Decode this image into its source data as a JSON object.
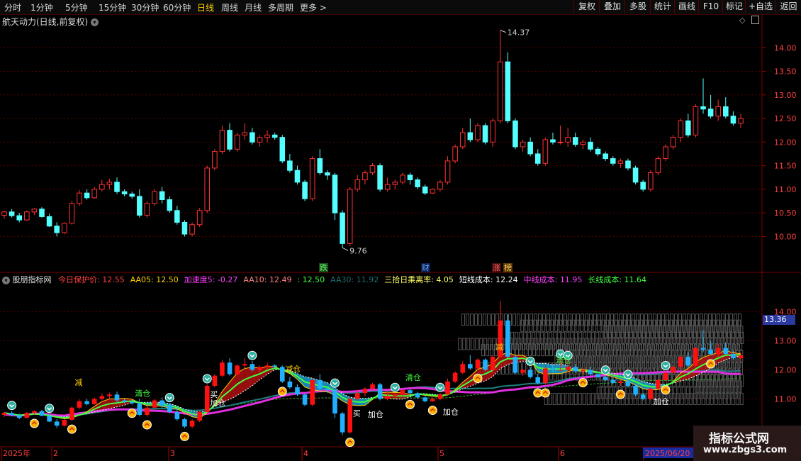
{
  "toolbar": {
    "periods": [
      {
        "label": "分时",
        "active": false
      },
      {
        "label": "1分钟",
        "active": false
      },
      {
        "label": "5分钟",
        "active": false
      },
      {
        "label": "15分钟",
        "active": false
      },
      {
        "label": "30分钟",
        "active": false
      },
      {
        "label": "60分钟",
        "active": false
      },
      {
        "label": "日线",
        "active": true
      },
      {
        "label": "周线",
        "active": false
      },
      {
        "label": "月线",
        "active": false
      },
      {
        "label": "多周期",
        "active": false
      },
      {
        "label": "更多",
        "active": false
      }
    ],
    "more_arrow": ">",
    "buttons": [
      "复权",
      "叠加",
      "多股",
      "统计",
      "画线",
      "F10",
      "标记",
      "+自选",
      "返回"
    ]
  },
  "stock": {
    "title": "航天动力(日线,前复权)",
    "high_label": "14.37",
    "low_label": "9.76",
    "event_markers": [
      "跌",
      "财",
      "涨",
      "榜"
    ]
  },
  "indicator": {
    "name": "股朋指标网",
    "params": [
      {
        "text": "今日保护价: 12.55",
        "color": "#ff4040"
      },
      {
        "text": "AA05: 12.50",
        "color": "#ffd200"
      },
      {
        "text": "加速度5: -0.27",
        "color": "#ff40ff"
      },
      {
        "text": "AA10: 12.49",
        "color": "#ff8080"
      },
      {
        "text": ": 12.50",
        "color": "#40ff40"
      },
      {
        "text": "AA30: 11.92",
        "color": "#1e6e6e"
      },
      {
        "text": "三拾日乘离率: 4.05",
        "color": "#ffff60"
      },
      {
        "text": "短线成本: 12.24",
        "color": "#ffffff"
      },
      {
        "text": "中线成本: 11.95",
        "color": "#ff40ff"
      },
      {
        "text": "长线成本: 11.64",
        "color": "#40ff40"
      }
    ],
    "current_value": "13.36",
    "signals": {
      "jian": "减",
      "qing": "清仓",
      "jiacang": "加仓",
      "mai": "买",
      "jianc": "减仓"
    }
  },
  "price_axis": {
    "main": [
      "14.00",
      "13.50",
      "13.00",
      "12.50",
      "12.00",
      "11.50",
      "11.00",
      "10.50",
      "10.00"
    ],
    "sub": [
      "14.00",
      "13.00",
      "12.00",
      "11.00"
    ]
  },
  "date_axis": {
    "labels": [
      {
        "text": "2025年"
      },
      {
        "text": "2"
      },
      {
        "text": "3"
      },
      {
        "text": "4"
      },
      {
        "text": "5"
      },
      {
        "text": "6"
      },
      {
        "text": "2025/06/20"
      }
    ]
  },
  "watermark": {
    "title": "指标公式网",
    "url": "www.zbgs3.com"
  },
  "chart_data": {
    "type": "candlestick",
    "title": "航天动力(日线,前复权)",
    "ylim": [
      9.6,
      14.5
    ],
    "bull_color": "#ff3232",
    "bear_color": "#54ffff",
    "candles": [
      [
        10.45,
        10.55,
        10.38,
        10.52
      ],
      [
        10.52,
        10.58,
        10.4,
        10.44
      ],
      [
        10.44,
        10.5,
        10.3,
        10.35
      ],
      [
        10.35,
        10.55,
        10.33,
        10.52
      ],
      [
        10.52,
        10.6,
        10.45,
        10.58
      ],
      [
        10.58,
        10.62,
        10.4,
        10.42
      ],
      [
        10.42,
        10.48,
        10.2,
        10.22
      ],
      [
        10.22,
        10.3,
        10.0,
        10.08
      ],
      [
        10.08,
        10.3,
        10.05,
        10.28
      ],
      [
        10.28,
        10.75,
        10.25,
        10.7
      ],
      [
        10.7,
        10.98,
        10.65,
        10.92
      ],
      [
        10.92,
        11.0,
        10.78,
        10.82
      ],
      [
        10.82,
        11.05,
        10.8,
        11.0
      ],
      [
        11.0,
        11.2,
        10.95,
        11.1
      ],
      [
        11.1,
        11.22,
        11.0,
        11.15
      ],
      [
        11.15,
        11.25,
        10.9,
        10.95
      ],
      [
        10.95,
        11.0,
        10.85,
        10.9
      ],
      [
        10.9,
        10.95,
        10.8,
        10.85
      ],
      [
        10.85,
        11.0,
        10.4,
        10.45
      ],
      [
        10.45,
        10.75,
        10.4,
        10.7
      ],
      [
        10.7,
        11.0,
        10.65,
        10.95
      ],
      [
        10.95,
        11.05,
        10.7,
        10.78
      ],
      [
        10.78,
        10.85,
        10.5,
        10.55
      ],
      [
        10.55,
        10.65,
        10.25,
        10.3
      ],
      [
        10.3,
        10.35,
        10.0,
        10.05
      ],
      [
        10.05,
        10.3,
        10.0,
        10.25
      ],
      [
        10.25,
        10.6,
        10.2,
        10.55
      ],
      [
        10.55,
        11.5,
        10.5,
        11.45
      ],
      [
        11.45,
        11.85,
        11.4,
        11.8
      ],
      [
        11.8,
        12.35,
        11.75,
        12.25
      ],
      [
        12.25,
        12.4,
        11.8,
        11.85
      ],
      [
        11.85,
        12.2,
        11.8,
        12.15
      ],
      [
        12.15,
        12.4,
        12.05,
        12.2
      ],
      [
        12.2,
        12.3,
        11.95,
        12.0
      ],
      [
        12.0,
        12.15,
        11.9,
        12.1
      ],
      [
        12.1,
        12.25,
        12.0,
        12.15
      ],
      [
        12.15,
        12.2,
        12.05,
        12.1
      ],
      [
        12.1,
        12.15,
        11.55,
        11.6
      ],
      [
        11.6,
        11.75,
        11.35,
        11.4
      ],
      [
        11.4,
        11.5,
        11.1,
        11.15
      ],
      [
        11.15,
        11.2,
        10.75,
        10.8
      ],
      [
        10.8,
        11.7,
        10.75,
        11.65
      ],
      [
        11.65,
        11.85,
        11.3,
        11.35
      ],
      [
        11.35,
        11.4,
        11.2,
        11.3
      ],
      [
        11.3,
        11.35,
        10.35,
        10.5
      ],
      [
        10.5,
        10.55,
        9.76,
        9.85
      ],
      [
        9.85,
        11.05,
        9.8,
        11.0
      ],
      [
        11.0,
        11.3,
        10.95,
        11.2
      ],
      [
        11.2,
        11.4,
        11.1,
        11.35
      ],
      [
        11.35,
        11.55,
        11.3,
        11.5
      ],
      [
        11.5,
        11.55,
        10.95,
        11.0
      ],
      [
        11.0,
        11.25,
        10.95,
        11.1
      ],
      [
        11.1,
        11.2,
        11.0,
        11.15
      ],
      [
        11.15,
        11.35,
        11.1,
        11.3
      ],
      [
        11.3,
        11.35,
        11.1,
        11.2
      ],
      [
        11.2,
        11.25,
        11.0,
        11.05
      ],
      [
        11.05,
        11.1,
        10.88,
        10.92
      ],
      [
        10.92,
        11.02,
        10.9,
        11.0
      ],
      [
        11.0,
        11.2,
        10.95,
        11.15
      ],
      [
        11.15,
        11.7,
        11.1,
        11.6
      ],
      [
        11.6,
        11.95,
        11.55,
        11.9
      ],
      [
        11.9,
        12.3,
        11.85,
        12.2
      ],
      [
        12.2,
        12.5,
        12.0,
        12.05
      ],
      [
        12.05,
        12.4,
        12.0,
        12.35
      ],
      [
        12.35,
        12.4,
        11.95,
        12.0
      ],
      [
        12.0,
        12.5,
        11.9,
        12.45
      ],
      [
        12.45,
        14.37,
        12.4,
        13.7
      ],
      [
        13.7,
        13.9,
        12.4,
        12.45
      ],
      [
        12.45,
        12.5,
        11.85,
        11.9
      ],
      [
        11.9,
        12.05,
        11.8,
        12.0
      ],
      [
        12.0,
        12.1,
        11.7,
        11.75
      ],
      [
        11.75,
        11.85,
        11.5,
        11.55
      ],
      [
        11.55,
        12.1,
        11.5,
        12.05
      ],
      [
        12.05,
        12.2,
        11.95,
        12.0
      ],
      [
        12.0,
        12.35,
        11.95,
        12.0
      ],
      [
        12.0,
        12.3,
        11.9,
        12.1
      ],
      [
        12.1,
        12.2,
        11.9,
        11.95
      ],
      [
        11.95,
        12.05,
        11.85,
        12.0
      ],
      [
        12.0,
        12.1,
        11.8,
        11.85
      ],
      [
        11.85,
        11.9,
        11.7,
        11.75
      ],
      [
        11.75,
        11.8,
        11.6,
        11.65
      ],
      [
        11.65,
        11.7,
        11.5,
        11.55
      ],
      [
        11.55,
        11.65,
        11.45,
        11.6
      ],
      [
        11.6,
        11.65,
        11.4,
        11.45
      ],
      [
        11.45,
        11.5,
        11.1,
        11.15
      ],
      [
        11.15,
        11.2,
        10.95,
        11.0
      ],
      [
        11.0,
        11.4,
        10.95,
        11.35
      ],
      [
        11.35,
        11.7,
        11.3,
        11.65
      ],
      [
        11.65,
        11.95,
        11.6,
        11.9
      ],
      [
        11.9,
        12.15,
        11.85,
        12.1
      ],
      [
        12.1,
        12.5,
        12.0,
        12.45
      ],
      [
        12.45,
        12.6,
        12.1,
        12.15
      ],
      [
        12.15,
        12.8,
        12.1,
        12.75
      ],
      [
        12.75,
        13.35,
        12.6,
        12.7
      ],
      [
        12.7,
        13.0,
        12.5,
        12.55
      ],
      [
        12.55,
        12.9,
        12.45,
        12.75
      ],
      [
        12.75,
        12.95,
        12.5,
        12.55
      ],
      [
        12.55,
        12.65,
        12.35,
        12.4
      ],
      [
        12.4,
        12.6,
        12.3,
        12.5
      ]
    ],
    "indicator_ylim": [
      9.4,
      14.6
    ],
    "ma_periods": [
      5,
      10,
      30
    ]
  }
}
